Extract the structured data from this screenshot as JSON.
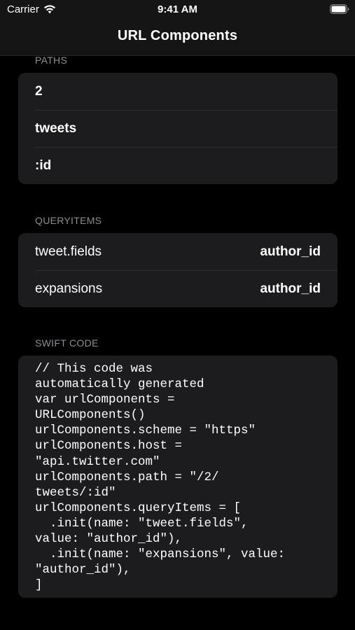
{
  "status_bar": {
    "carrier": "Carrier",
    "time": "9:41 AM"
  },
  "nav": {
    "title": "URL Components"
  },
  "sections": {
    "paths": {
      "header": "PATHS",
      "items": [
        "2",
        "tweets",
        ":id"
      ]
    },
    "query_items": {
      "header": "QUERYITEMS",
      "items": [
        {
          "name": "tweet.fields",
          "value": "author_id"
        },
        {
          "name": "expansions",
          "value": "author_id"
        }
      ]
    },
    "swift_code": {
      "header": "SWIFT CODE",
      "lines": [
        "// This code was",
        "automatically generated",
        "var urlComponents =",
        "URLComponents()",
        "urlComponents.scheme = \"https\"",
        "urlComponents.host =",
        "\"api.twitter.com\"",
        "urlComponents.path = \"/2/",
        "tweets/:id\"",
        "urlComponents.queryItems = [",
        "  .init(name: \"tweet.fields\",",
        "value: \"author_id\"),",
        "  .init(name: \"expansions\", value:",
        "\"author_id\"),",
        "]"
      ]
    }
  },
  "icons": {
    "wifi": "wifi-icon",
    "battery": "battery-icon"
  },
  "colors": {
    "background": "#000000",
    "cell": "#1c1c1e",
    "section_header": "#8d8d93",
    "separator": "#2e2e31"
  }
}
